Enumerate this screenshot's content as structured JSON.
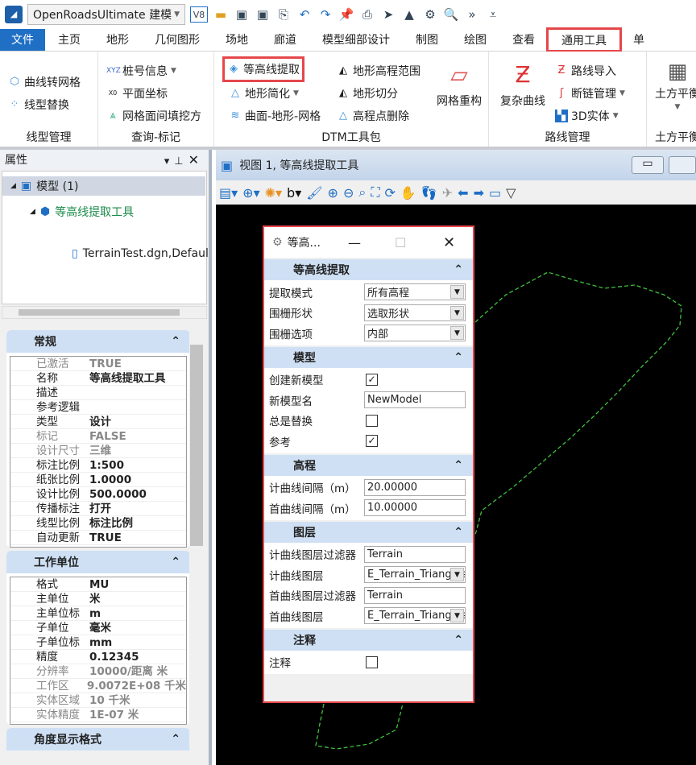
{
  "qat": {
    "workspace": "OpenRoadsUltimate 建模",
    "v8": "V8"
  },
  "tabs": [
    "文件",
    "主页",
    "地形",
    "几何图形",
    "场地",
    "廊道",
    "模型细部设计",
    "制图",
    "绘图",
    "查看",
    "通用工具",
    "单"
  ],
  "ribbon": {
    "g1": {
      "label": "线型管理",
      "items": [
        "曲线转网格",
        "线型替换"
      ]
    },
    "g2": {
      "label": "查询-标记",
      "items": [
        "桩号信息",
        "平面坐标",
        "网格面间填挖方"
      ]
    },
    "g3": {
      "label": "DTM工具包",
      "items": [
        "等高线提取",
        "地形简化",
        "曲面-地形-网格",
        "地形高程范围",
        "地形切分",
        "高程点删除",
        "网格重构"
      ]
    },
    "g4": {
      "label": "路线管理",
      "items": [
        "复杂曲线",
        "路线导入",
        "断链管理",
        "3D实体"
      ]
    },
    "g5": {
      "label": "土方平衡",
      "items": [
        "土方平衡"
      ]
    }
  },
  "props": {
    "title": "属性",
    "tree": [
      "模型 (1)",
      "等高线提取工具",
      "TerrainTest.dgn,Defaul"
    ],
    "general": {
      "title": "常规",
      "rows": [
        [
          "已激活",
          "TRUE",
          1
        ],
        [
          "名称",
          "等高线提取工具",
          0
        ],
        [
          "描述",
          "",
          0
        ],
        [
          "参考逻辑",
          "",
          0
        ],
        [
          "类型",
          "设计",
          0
        ],
        [
          "标记",
          "FALSE",
          1
        ],
        [
          "设计尺寸",
          "三维",
          1
        ],
        [
          "标注比例",
          "1:500",
          0
        ],
        [
          "纸张比例",
          "1.0000",
          0
        ],
        [
          "设计比例",
          "500.0000",
          0
        ],
        [
          "传播标注",
          "打开",
          0
        ],
        [
          "线型比例",
          "标注比例",
          0
        ],
        [
          "自动更新",
          "TRUE",
          0
        ]
      ]
    },
    "units": {
      "title": "工作单位",
      "rows": [
        [
          "格式",
          "MU",
          0
        ],
        [
          "主单位",
          "米",
          0
        ],
        [
          "主单位标",
          "m",
          0
        ],
        [
          "子单位",
          "毫米",
          0
        ],
        [
          "子单位标",
          "mm",
          0
        ],
        [
          "精度",
          "0.12345",
          0
        ],
        [
          "分辨率",
          "10000/距离 米",
          1
        ],
        [
          "工作区",
          "9.0072E+08 千米",
          1
        ],
        [
          "实体区域",
          "10 千米",
          1
        ],
        [
          "实体精度",
          "1E-07 米",
          1
        ]
      ]
    },
    "angle": {
      "title": "角度显示格式"
    }
  },
  "view": {
    "title": "视图 1, 等高线提取工具"
  },
  "dialog": {
    "title": "等高...",
    "s1": {
      "title": "等高线提取",
      "rows": [
        {
          "k": "提取模式",
          "v": "所有高程"
        },
        {
          "k": "围栅形状",
          "v": "选取形状"
        },
        {
          "k": "围栅选项",
          "v": "内部"
        }
      ]
    },
    "s2": {
      "title": "模型",
      "create": "创建新模型",
      "name_label": "新模型名",
      "name": "NewModel",
      "replace": "总是替换",
      "ref": "参考"
    },
    "s3": {
      "title": "高程",
      "rows": [
        {
          "k": "计曲线间隔（m）",
          "v": "20.00000"
        },
        {
          "k": "首曲线间隔（m）",
          "v": "10.00000"
        }
      ]
    },
    "s4": {
      "title": "图层",
      "rows": [
        {
          "k": "计曲线图层过滤器",
          "v": "Terrain",
          "t": "inp"
        },
        {
          "k": "计曲线图层",
          "v": "E_Terrain_Triangles",
          "t": "sel"
        },
        {
          "k": "首曲线图层过滤器",
          "v": "Terrain",
          "t": "inp"
        },
        {
          "k": "首曲线图层",
          "v": "E_Terrain_Triangles",
          "t": "sel"
        }
      ]
    },
    "s5": {
      "title": "注释",
      "label": "注释"
    }
  },
  "colors": {
    "accent": "#1f6fc5",
    "highlight": "#e5474b",
    "section": "#cfe0f5",
    "contour": "#3fbf3f"
  }
}
